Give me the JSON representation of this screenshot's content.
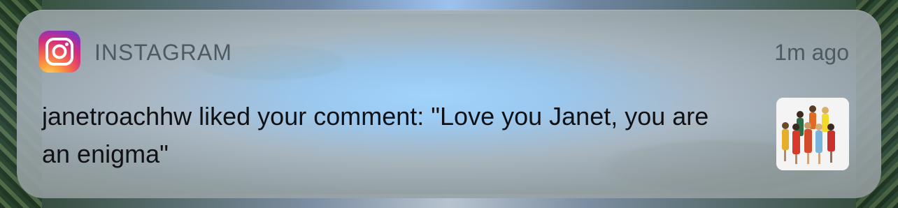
{
  "notification": {
    "app_name": "INSTAGRAM",
    "timestamp": "1m ago",
    "message": "janetroachhw liked your comment: \"Love you Janet, you are an enigma\"",
    "app_icon": "instagram-icon",
    "thumbnail": "post-thumbnail"
  },
  "colors": {
    "instagram_gradient": [
      "#fdd86b",
      "#fba43f",
      "#f15d55",
      "#d2307d",
      "#8c33b6",
      "#5b4ed1"
    ],
    "card_tint": "#9dcbf2",
    "secondary_text": "#4f5a60",
    "primary_text": "#0f1114"
  }
}
